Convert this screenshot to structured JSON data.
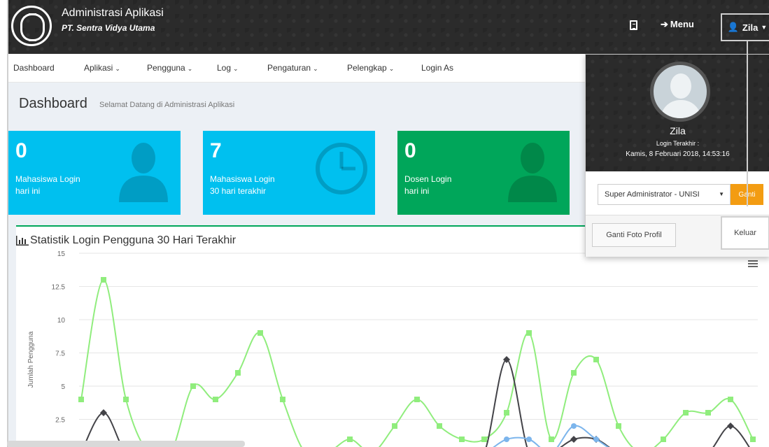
{
  "app": {
    "title": "Administrasi Aplikasi",
    "subtitle": "PT. Sentra Vidya Utama",
    "menu_label": "Menu",
    "user_label": "Zila"
  },
  "nav": {
    "items": [
      {
        "label": "Dashboard",
        "has_caret": false
      },
      {
        "label": "Aplikasi",
        "has_caret": true
      },
      {
        "label": "Pengguna",
        "has_caret": true
      },
      {
        "label": "Log",
        "has_caret": true
      },
      {
        "label": "Pengaturan",
        "has_caret": true
      },
      {
        "label": "Pelengkap",
        "has_caret": true
      },
      {
        "label": "Login As",
        "has_caret": false
      }
    ]
  },
  "page": {
    "title": "Dashboard",
    "subtitle": "Selamat Datang di Administrasi Aplikasi"
  },
  "tiles": [
    {
      "value": "0",
      "line1": "Mahasiswa Login",
      "line2": "hari ini",
      "icon": "user-icon",
      "color": "#00c0ef"
    },
    {
      "value": "7",
      "line1": "Mahasiswa Login",
      "line2": "30 hari terakhir",
      "icon": "clock-icon",
      "color": "#00c0ef"
    },
    {
      "value": "0",
      "line1": "Dosen Login",
      "line2": "hari ini",
      "icon": "user-icon",
      "color": "#00a65a"
    }
  ],
  "chart_panel": {
    "title": "Statistik Login Pengguna 30 Hari Terakhir"
  },
  "chart_data": {
    "type": "line",
    "ylabel": "Jumlah Pengguna",
    "yticks": [
      "2.5",
      "5",
      "7.5",
      "10",
      "12.5",
      "15"
    ],
    "ylim": [
      0,
      15
    ],
    "series": [
      {
        "color": "#90ed7d",
        "marker": "square",
        "values": [
          4,
          13,
          4,
          0,
          0,
          5,
          4,
          6,
          9,
          4,
          0,
          0,
          1,
          0,
          2,
          4,
          2,
          1,
          1,
          3,
          9,
          1,
          6,
          7,
          2,
          0,
          1,
          3,
          3,
          4,
          1
        ]
      },
      {
        "color": "#434348",
        "marker": "diamond",
        "values": [
          0,
          3,
          0,
          0,
          0,
          0,
          0,
          0,
          0,
          0,
          0,
          0,
          0,
          0,
          0,
          0,
          0,
          0,
          0,
          7,
          0,
          0,
          1,
          1,
          0,
          0,
          0,
          0,
          0,
          2,
          0
        ]
      },
      {
        "color": "#7cb5ec",
        "marker": "circle",
        "values": [
          0,
          0,
          0,
          0,
          0,
          0,
          0,
          0,
          0,
          0,
          0,
          0,
          0,
          0,
          0,
          0,
          0,
          0,
          0,
          1,
          1,
          0,
          2,
          1,
          0,
          0,
          0,
          0,
          0,
          0,
          0
        ]
      }
    ],
    "grid": true,
    "legend": "none"
  },
  "dropdown": {
    "name": "Zila",
    "last_login_label": "Login Terakhir :",
    "last_login_time": "Kamis, 8 Februari 2018, 14:53:16",
    "role_value": "Super Administrator - UNISI",
    "ganti_label": "Ganti",
    "ganti_foto_label": "Ganti Foto Profil",
    "keluar_label": "Keluar"
  }
}
